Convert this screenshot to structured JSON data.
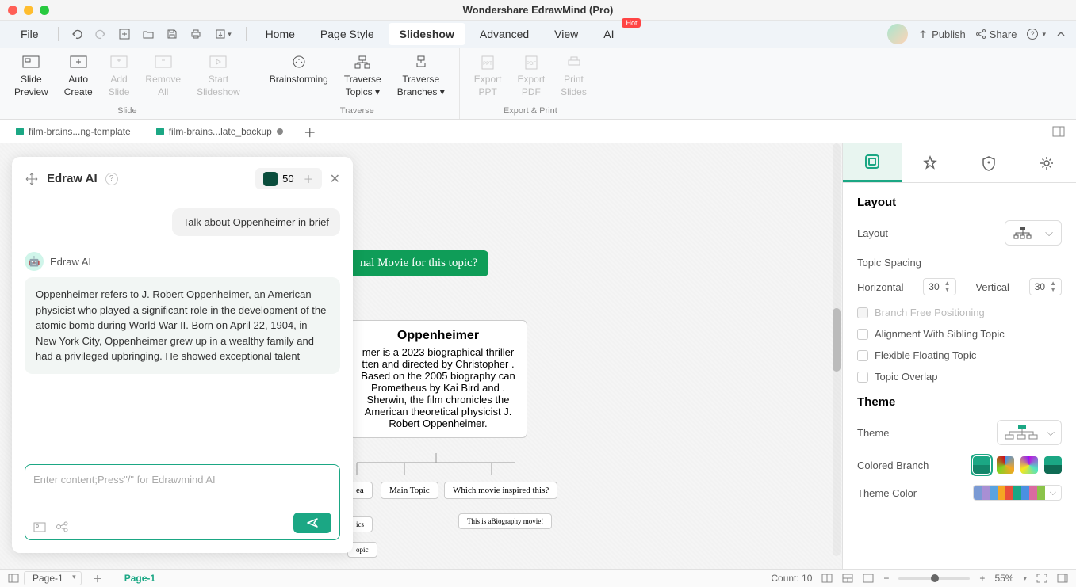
{
  "titlebar": {
    "title": "Wondershare EdrawMind (Pro)"
  },
  "menubar": {
    "file": "File",
    "items": [
      "Home",
      "Page Style",
      "Slideshow",
      "Advanced",
      "View",
      "AI"
    ],
    "active": "Slideshow",
    "hot": "Hot",
    "publish": "Publish",
    "share": "Share"
  },
  "ribbon": {
    "slide": {
      "preview": "Slide\nPreview",
      "auto": "Auto\nCreate",
      "add": "Add\nSlide",
      "remove": "Remove\nAll",
      "start": "Start\nSlideshow",
      "group": "Slide"
    },
    "traverse": {
      "brain": "Brainstorming",
      "topics": "Traverse\nTopics",
      "branches": "Traverse\nBranches",
      "group": "Traverse"
    },
    "export": {
      "ppt": "Export\nPPT",
      "pdf": "Export\nPDF",
      "print": "Print\nSlides",
      "group": "Export & Print"
    }
  },
  "tabs": {
    "t1": "film-brains...ng-template",
    "t2": "film-brains...late_backup"
  },
  "ai": {
    "title": "Edraw AI",
    "credits": "50",
    "user_msg": "Talk about Oppenheimer in brief",
    "bot_name": "Edraw AI",
    "bot_msg": "Oppenheimer refers to J. Robert Oppenheimer, an American physicist who played a significant role in the development of the atomic bomb during World War II. Born on April 22, 1904, in New York City, Oppenheimer grew up in a wealthy family and had a privileged upbringing. He showed exceptional talent",
    "placeholder": "Enter content;Press\"/\" for Edrawmind AI"
  },
  "canvas": {
    "green": "nal Movie for this topic?",
    "main_title": "Oppenheimer",
    "main_body": "mer is a 2023 biographical thriller tten and directed by Christopher . Based on the 2005 biography can Prometheus by Kai Bird and . Sherwin, the film chronicles the American theoretical physicist J. Robert Oppenheimer.",
    "n1": "ea",
    "n2": "Main Topic",
    "n3": "Which movie inspired this?",
    "n4": "ics",
    "n5": "This is aBiography movie!",
    "n6": "opic"
  },
  "side": {
    "layout_h": "Layout",
    "layout_lbl": "Layout",
    "spacing": "Topic Spacing",
    "horiz": "Horizontal",
    "horiz_v": "30",
    "vert": "Vertical",
    "vert_v": "30",
    "chk1": "Branch Free Positioning",
    "chk2": "Alignment With Sibling Topic",
    "chk3": "Flexible Floating Topic",
    "chk4": "Topic Overlap",
    "theme_h": "Theme",
    "theme_lbl": "Theme",
    "cbranch": "Colored Branch",
    "tcolor": "Theme Color"
  },
  "status": {
    "page_sel": "Page-1",
    "page_tab": "Page-1",
    "count": "Count: 10",
    "zoom": "55%"
  }
}
